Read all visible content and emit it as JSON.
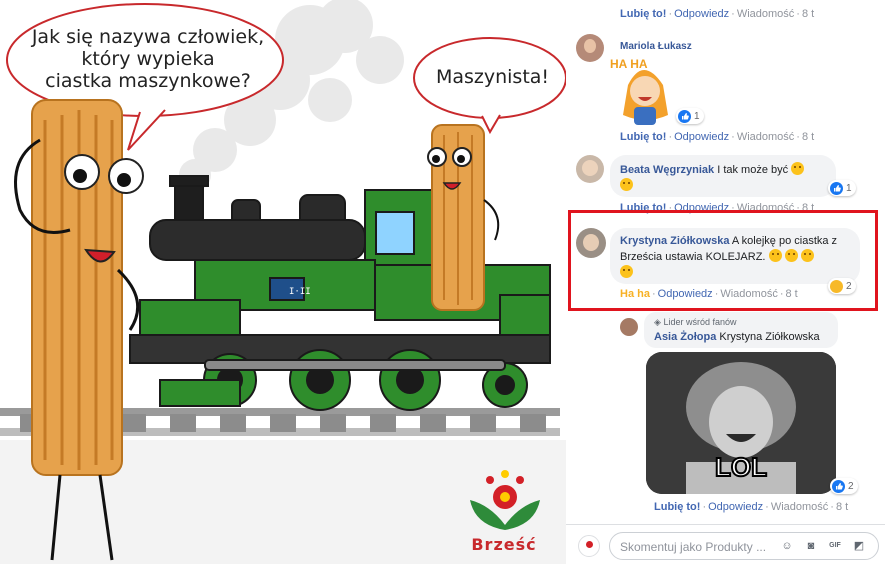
{
  "post": {
    "bubble1": [
      "Jak się nazywa człowiek,",
      "który wypieka",
      "ciastka maszynkowe?"
    ],
    "bubble2": "Maszynista!",
    "brand": "Brześć",
    "loco_plate": "I·II"
  },
  "top_actions": {
    "like": "Lubię to!",
    "reply": "Odpowiedz",
    "message": "Wiadomość",
    "time": "8 t"
  },
  "comments": [
    {
      "author": "Mariola Łukasz",
      "sticker_text": "HA HA",
      "reaction_count": "1",
      "actions": {
        "like": "Lubię to!",
        "reply": "Odpowiedz",
        "message": "Wiadomość",
        "time": "8 t"
      }
    },
    {
      "author": "Beata Węgrzyniak",
      "text": "I tak może być",
      "reaction_count": "1",
      "actions": {
        "like": "Lubię to!",
        "reply": "Odpowiedz",
        "message": "Wiadomość",
        "time": "8 t"
      }
    },
    {
      "author": "Krystyna Ziółkowska",
      "text": "A kolejkę po ciastka z Brześcia ustawia KOLEJARZ.",
      "reaction_count": "2",
      "actions": {
        "like": "Ha ha",
        "reply": "Odpowiedz",
        "message": "Wiadomość",
        "time": "8 t"
      }
    },
    {
      "badge": "Lider wśród fanów",
      "author": "Asia Żołopa",
      "text": "Krystyna Ziółkowska",
      "gif_caption": "LOL",
      "reaction_count": "2",
      "actions": {
        "like": "Lubię to!",
        "reply": "Odpowiedz",
        "message": "Wiadomość",
        "time": "8 t"
      }
    }
  ],
  "composer": {
    "placeholder": "Skomentuj jako Produkty ..."
  },
  "colors": {
    "highlight": "#e0141e",
    "link": "#385898",
    "action": "#4267b2",
    "haha": "#f7b125",
    "loco_green": "#2f8d2c"
  }
}
